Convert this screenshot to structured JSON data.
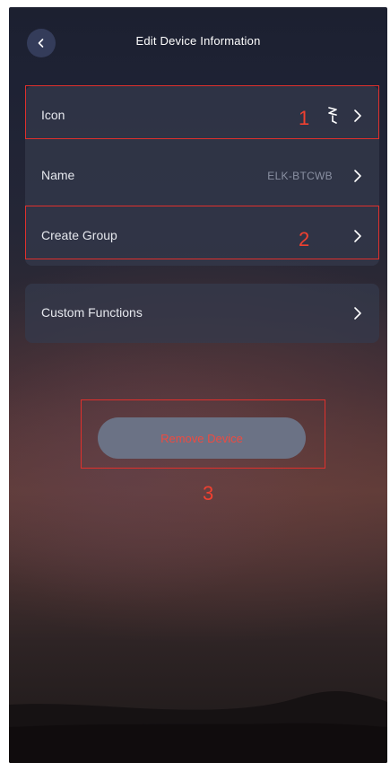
{
  "header": {
    "title": "Edit Device Information",
    "back_icon": "chevron-left-icon"
  },
  "settings": {
    "rows": [
      {
        "label": "Icon",
        "value": "",
        "icon": "lamp-icon"
      },
      {
        "label": "Name",
        "value": "ELK-BTCWB"
      },
      {
        "label": "Create Group",
        "value": ""
      }
    ],
    "custom_functions": {
      "label": "Custom Functions"
    }
  },
  "actions": {
    "remove_label": "Remove Device"
  },
  "annotations": [
    "1",
    "2",
    "3"
  ],
  "colors": {
    "annotation": "#e0302c",
    "remove_text": "#ee4a40",
    "button_bg": "#6b7285"
  }
}
